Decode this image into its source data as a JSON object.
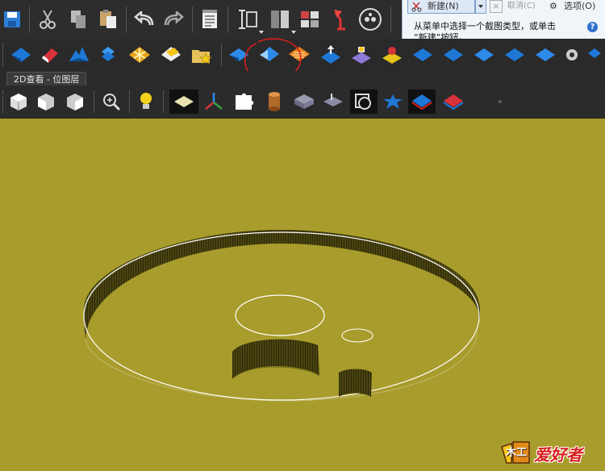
{
  "tab": {
    "label": "2D查看 - 位图层"
  },
  "snip_popup": {
    "new_label": "新建(N)",
    "cancel_label": "取消(C)",
    "options_label": "选项(O)",
    "description_line1": "从菜单中选择一个截图类型，或单击",
    "description_line2": "“新建”按钮。",
    "help_glyph": "?"
  },
  "watermark": {
    "text": "爱好者",
    "prefix": "木工"
  },
  "colors": {
    "canvas": "#a89c2c",
    "toolbar": "#2b2b2b",
    "accent_blue": "#1e78d7",
    "highlight_red": "#d81e1e"
  }
}
